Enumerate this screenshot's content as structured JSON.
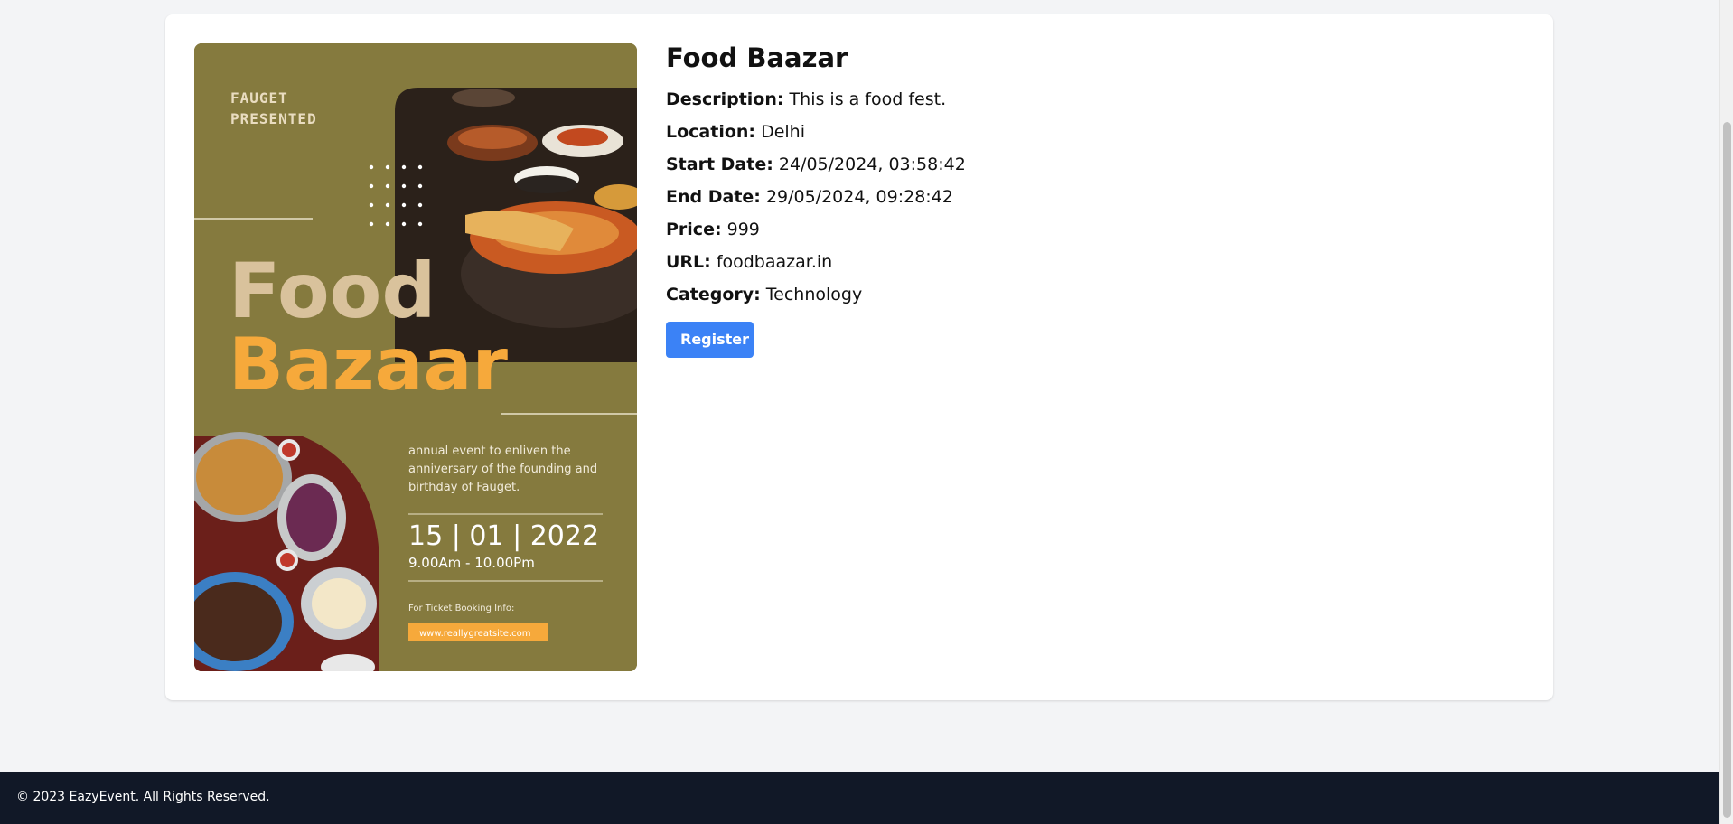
{
  "event": {
    "title": "Food Baazar",
    "fields": [
      {
        "label": "Description:",
        "value": "This is a food fest."
      },
      {
        "label": "Location:",
        "value": "Delhi"
      },
      {
        "label": "Start Date:",
        "value": "24/05/2024, 03:58:42"
      },
      {
        "label": "End Date:",
        "value": "29/05/2024, 09:28:42"
      },
      {
        "label": "Price:",
        "value": "999"
      },
      {
        "label": "URL:",
        "value": "foodbaazar.in"
      },
      {
        "label": "Category:",
        "value": "Technology"
      }
    ],
    "register_label": "Register"
  },
  "poster": {
    "presenter_line1": "FAUGET",
    "presenter_line2": "PRESENTED",
    "headline_1": "Food",
    "headline_2": "Bazaar",
    "blurb_1": "annual event to enliven the",
    "blurb_2": "anniversary of the founding and",
    "blurb_3": "birthday of Fauget.",
    "date": "15 | 01 | 2022",
    "time": "9.00Am - 10.00Pm",
    "booking_label": "For Ticket Booking Info:",
    "booking_site": "www.reallygreatsite.com",
    "colors": {
      "background": "#857a3e",
      "accent": "#f6a93b",
      "headline": "#d9c29c"
    }
  },
  "footer": {
    "copyright": "© 2023 EazyEvent. All Rights Reserved."
  },
  "colors": {
    "button": "#3b82f6",
    "footer": "#111827",
    "page": "#f3f4f6"
  }
}
